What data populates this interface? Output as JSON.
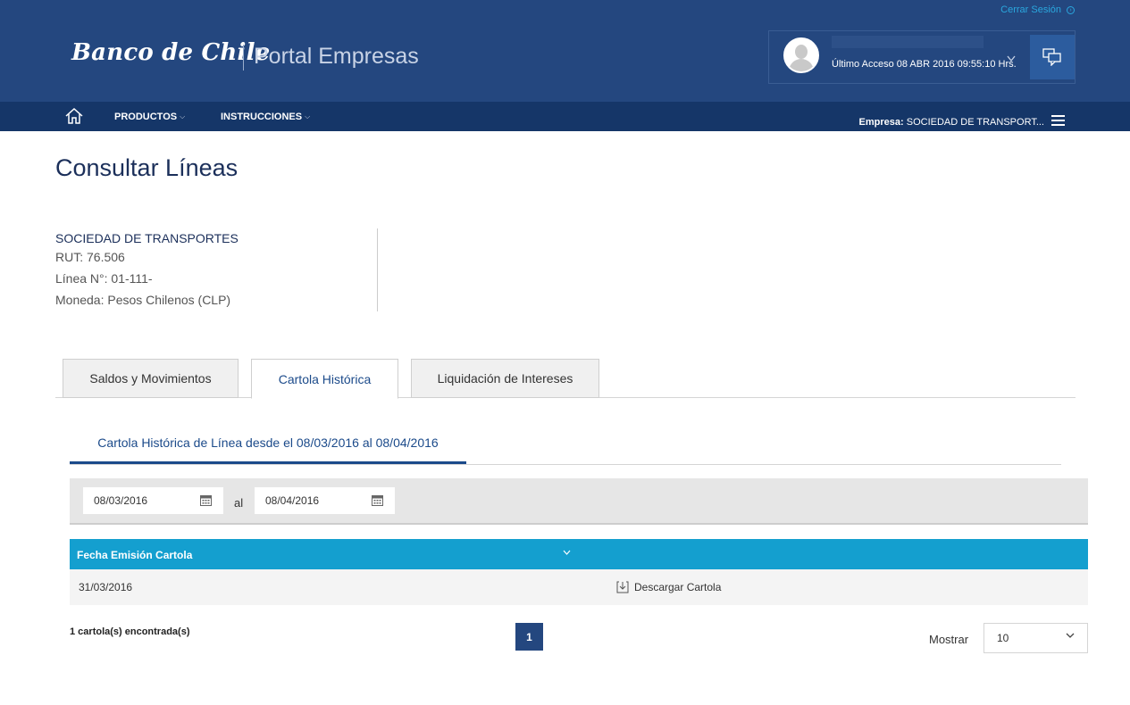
{
  "header": {
    "logout_label": "Cerrar Sesión",
    "logo_text": "Banco de Chile",
    "portal_title": "Portal Empresas",
    "last_access": "Último Acceso 08 ABR 2016 09:55:10 Hrs.",
    "brand_color": "#24477f",
    "nav_color": "#153668"
  },
  "nav": {
    "items": [
      {
        "label": "PRODUCTOS"
      },
      {
        "label": "INSTRUCCIONES"
      }
    ],
    "empresa_label": "Empresa:",
    "empresa_value": "SOCIEDAD DE TRANSPORT..."
  },
  "page": {
    "title": "Consultar Líneas"
  },
  "info": {
    "company": "SOCIEDAD DE TRANSPORTES",
    "rut": "RUT: 76.506",
    "linea": "Línea N°: 01-111-",
    "moneda": "Moneda: Pesos Chilenos (CLP)"
  },
  "tabs": [
    {
      "label": "Saldos y Movimientos",
      "active": false
    },
    {
      "label": "Cartola Histórica",
      "active": true
    },
    {
      "label": "Liquidación de Intereses",
      "active": false
    }
  ],
  "subtab": {
    "label": "Cartola Histórica de Línea desde el 08/03/2016 al 08/04/2016"
  },
  "filter": {
    "date_from": "08/03/2016",
    "separator": "al",
    "date_to": "08/04/2016"
  },
  "table": {
    "header_color": "#149fcf",
    "columns": [
      "Fecha Emisión Cartola"
    ],
    "rows": [
      {
        "date": "31/03/2016",
        "action": "Descargar Cartola"
      }
    ]
  },
  "footer": {
    "found": "1 cartola(s) encontrada(s)",
    "current_page": "1",
    "show_label": "Mostrar",
    "show_value": "10"
  }
}
